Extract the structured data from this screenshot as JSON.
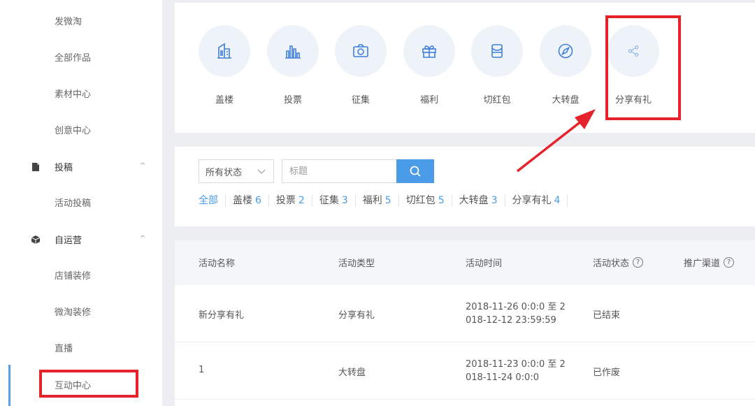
{
  "sidebar": {
    "items_top": [
      "发微淘",
      "全部作品",
      "素材中心",
      "创意中心"
    ],
    "section_tougao": {
      "label": "投稿",
      "caret": "^"
    },
    "tougao_items": [
      "活动投稿"
    ],
    "section_ziyunying": {
      "label": "自运营",
      "caret": "^"
    },
    "ziyunying_items": [
      "店铺装修",
      "微淘装修",
      "直播",
      "互动中心"
    ]
  },
  "activity_types": [
    {
      "label": "盖楼",
      "icon": "building-icon"
    },
    {
      "label": "投票",
      "icon": "bar-chart-icon"
    },
    {
      "label": "征集",
      "icon": "camera-icon"
    },
    {
      "label": "福利",
      "icon": "gift-icon"
    },
    {
      "label": "切红包",
      "icon": "red-envelope-icon"
    },
    {
      "label": "大转盘",
      "icon": "compass-icon"
    },
    {
      "label": "分享有礼",
      "icon": "share-icon"
    }
  ],
  "filter": {
    "status_select": "所有状态",
    "search_placeholder": "标题",
    "tabs": [
      {
        "label": "全部",
        "count": ""
      },
      {
        "label": "盖楼",
        "count": "6"
      },
      {
        "label": "投票",
        "count": "2"
      },
      {
        "label": "征集",
        "count": "3"
      },
      {
        "label": "福利",
        "count": "5"
      },
      {
        "label": "切红包",
        "count": "5"
      },
      {
        "label": "大转盘",
        "count": "3"
      },
      {
        "label": "分享有礼",
        "count": "4"
      }
    ]
  },
  "table": {
    "headers": [
      "活动名称",
      "活动类型",
      "活动时间",
      "活动状态",
      "推广渠道"
    ],
    "rows": [
      {
        "name": "新分享有礼",
        "type": "分享有礼",
        "time_line1": "2018-11-26 0:0:0 至 2",
        "time_line2": "018-12-12 23:59:59",
        "status": "已结束"
      },
      {
        "name": "1",
        "type": "大转盘",
        "time_line1": "2018-11-23 0:0:0 至 2",
        "time_line2": "018-11-24 0:0:0",
        "status": "已作废"
      }
    ]
  },
  "colors": {
    "accent": "#4a9be8",
    "highlight": "#e6232a"
  }
}
